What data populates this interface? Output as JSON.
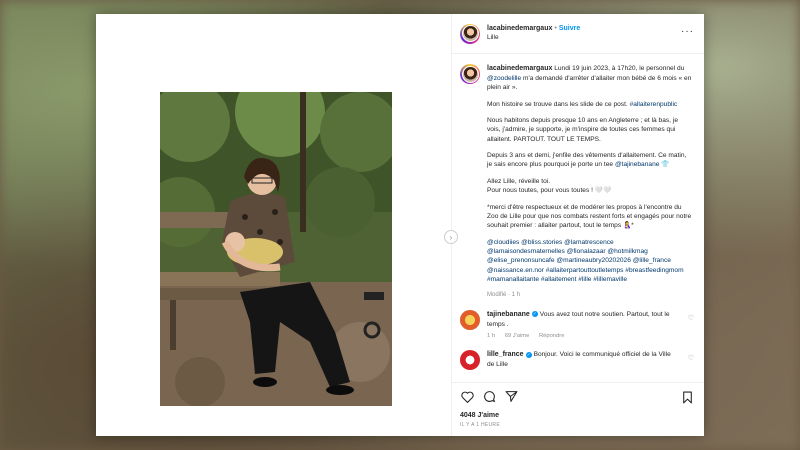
{
  "post": {
    "username": "lacabinedemargaux",
    "follow_label": "Suivre",
    "separator": "•",
    "location": "Lille",
    "caption": {
      "intro_rest": " Lundi 19 juin 2023, à 17h20, le personnel du ",
      "mention_zoo": "@zoodelille",
      "intro_tail": " m'a demandé d'arrêter d'allaiter mon bébé de 6 mois « en plein air ».",
      "p2_text": "Mon histoire se trouve dans les slide de ce post. ",
      "p2_tag": "#allaiterenpublic",
      "p3": "Nous habitons depuis presque 10 ans en Angleterre ; et là bas, je vois, j'admire, je supporte, je m'inspire de toutes ces femmes qui allaitent. PARTOUT. TOUT LE TEMPS.",
      "p4_text": "Depuis 3 ans et demi, j'enfile des vêtements d'allaitement. Ce matin, je sais encore plus pourquoi je porte un tee ",
      "p4_mention": "@tajinebanane",
      "p4_emoji": "👕",
      "p5_line1": "Allez Lille, réveille toi.",
      "p5_line2": "Pour nous toutes, pour vous toutes ! 🤍🤍",
      "p6": "*merci d'être respectueux et de modérer les propos à l'encontre du Zoo de Lille pour que nos combats restent forts et engagés pour notre souhait premier : allaiter partout, tout le temps 🤱*",
      "mentions_line": "@cloudiies @bliss.stories @lamatrescence @lamaisondesmaternelles @fionalazaar @hotmilkmag @elise_prenonsuncafe @martineaubry20202026 @lille_france @naissance.en.nor #allaiterpartouttoutletemps #breastfeedingmom #mamanallaitante #allaitement #lille #lillemaville",
      "modified": "Modifié · 1 h"
    },
    "comments": [
      {
        "username": "tajinebanane",
        "text": "Vous avez tout notre soutien. Partout, tout le temps .",
        "time": "1 h",
        "likes": "69 J'aime",
        "reply": "Répondre"
      },
      {
        "username": "lille_france",
        "text": "Bonjour. Voici le communiqué officiel de la Ville de Lille",
        "time": "",
        "likes": "",
        "reply": ""
      }
    ],
    "verified_glyph": "✓",
    "likes_count": "4048 J'aime",
    "date": "IL Y A 1 HEURE",
    "icons": [
      "heart-icon",
      "comment-icon",
      "share-icon",
      "bookmark-icon",
      "more-icon",
      "chevron-right-icon"
    ],
    "colors": {
      "accent": "#0095f6",
      "mention": "#00376b",
      "muted": "#8e8e8e",
      "text": "#262626"
    }
  }
}
